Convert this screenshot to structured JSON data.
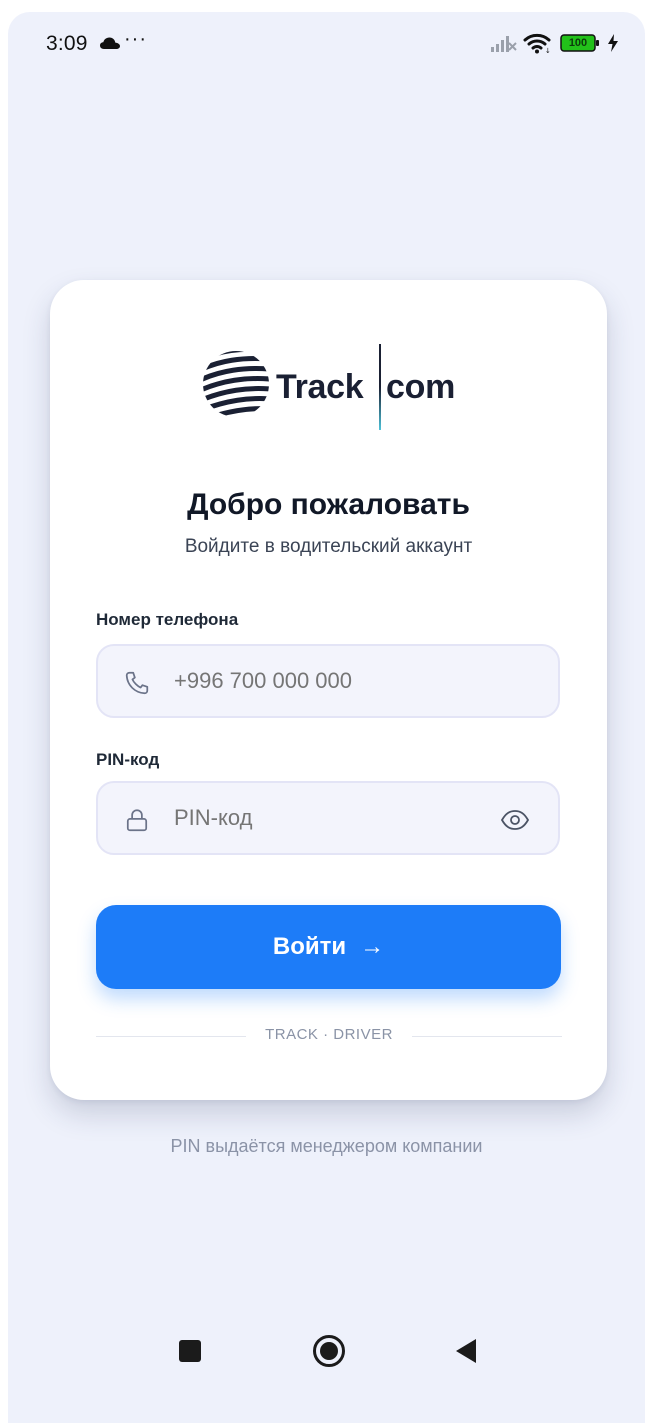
{
  "status_bar": {
    "time": "3:09",
    "more": "···",
    "battery": "100"
  },
  "logo": {
    "word1": "Track",
    "word2": "com"
  },
  "login": {
    "title": "Добро пожаловать",
    "subtitle": "Войдите в водительский аккаунт",
    "phone_label": "Номер телефона",
    "phone_placeholder": "+996 700 000 000",
    "pin_label": "PIN-код",
    "pin_placeholder": "PIN-код",
    "submit_label": "Войти",
    "submit_arrow": "→",
    "divider_text": "TRACK · DRIVER"
  },
  "footer": {
    "note": "PIN выдаётся менеджером компании"
  },
  "colors": {
    "accent": "#1d7cf8",
    "background": "#eef1fb",
    "card": "#ffffff"
  },
  "icons": [
    "cloud-icon",
    "signal-icon",
    "wifi-icon",
    "battery-icon",
    "bolt-icon",
    "phone-icon",
    "lock-icon",
    "eye-icon",
    "arrow-right-icon",
    "nav-recents-icon",
    "nav-home-icon",
    "nav-back-icon"
  ]
}
